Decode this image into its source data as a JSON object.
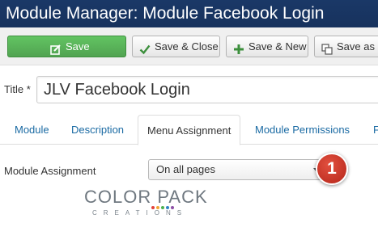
{
  "header": {
    "title": "Module Manager: Module Facebook Login"
  },
  "toolbar": {
    "save": "Save",
    "save_close": "Save & Close",
    "save_new": "Save & New",
    "save_copy": "Save as C"
  },
  "form": {
    "title_label": "Title *",
    "title_value": "JLV Facebook Login"
  },
  "tabs": [
    {
      "label": "Module"
    },
    {
      "label": "Description"
    },
    {
      "label": "Menu Assignment"
    },
    {
      "label": "Module Permissions"
    },
    {
      "label": "F"
    }
  ],
  "assignment": {
    "label": "Module Assignment",
    "selected": "On all pages"
  },
  "badge": "1",
  "logo": {
    "main": "COLOR PACK",
    "sub": "CREATIONS",
    "dot_colors": [
      "#e2403a",
      "#f3a632",
      "#4bb04f",
      "#2f84c6",
      "#8d4fa6"
    ]
  },
  "colors": {
    "header_bg": "#1a3867",
    "save_green": "#51a351",
    "link_blue": "#1a6aa3",
    "badge_red": "#c0392b"
  }
}
